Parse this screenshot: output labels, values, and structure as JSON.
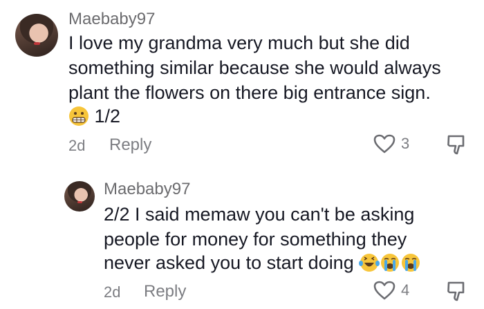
{
  "comments": [
    {
      "username": "Maebaby97",
      "lines": [
        "I love my grandma very much but she did",
        "something similar because she would always",
        "plant the flowers on there big entrance sign.",
        "1/2"
      ],
      "emoji": "grimacing-face-emoji",
      "age": "2d",
      "reply_label": "Reply",
      "likes": "3"
    },
    {
      "username": "Maebaby97",
      "lines": [
        "2/2 I said memaw you can't be asking",
        "people for money for something they",
        "never asked you to start doing"
      ],
      "emoji": [
        "laughing-tears-emoji",
        "loudly-crying-face-emoji",
        "loudly-crying-face-emoji"
      ],
      "age": "2d",
      "reply_label": "Reply",
      "likes": "4"
    }
  ],
  "colors": {
    "text": "#161823",
    "muted": "#7c7d82",
    "emoji_yellow": "#f7c53a"
  }
}
